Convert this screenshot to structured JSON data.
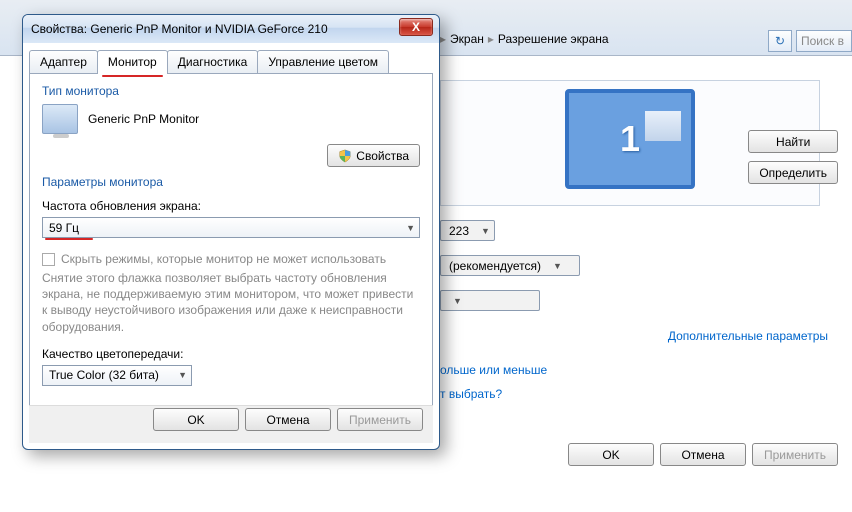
{
  "breadcrumb": {
    "item1": "Экран",
    "item2": "Разрешение экрана"
  },
  "search_placeholder": "Поиск в",
  "side": {
    "find": "Найти",
    "detect": "Определить"
  },
  "monitor_number": "1",
  "bg_rows": {
    "size": "223",
    "recommended": "(рекомендуется)"
  },
  "links": {
    "advanced": "Дополнительные параметры",
    "more_less": "ольше или меньше",
    "which": "т выбрать?"
  },
  "bottom": {
    "ok": "OK",
    "cancel": "Отмена",
    "apply": "Применить"
  },
  "dialog": {
    "title": "Свойства: Generic PnP Monitor и NVIDIA GeForce 210",
    "close": "X",
    "tabs": {
      "adapter": "Адаптер",
      "monitor": "Монитор",
      "diag": "Диагностика",
      "color": "Управление цветом"
    },
    "group_type": "Тип монитора",
    "monitor_name": "Generic PnP Monitor",
    "properties": "Свойства",
    "group_params": "Параметры монитора",
    "refresh_label": "Частота обновления экрана:",
    "refresh_value": "59 Гц",
    "hide_modes": "Скрыть режимы, которые монитор не может использовать",
    "hint": "Снятие этого флажка позволяет выбрать частоту обновления экрана, не поддерживаемую этим монитором, что может привести к выводу неустойчивого изображения или даже к неисправности оборудования.",
    "quality_label": "Качество цветопередачи:",
    "quality_value": "True Color (32 бита)",
    "ok": "OK",
    "cancel": "Отмена",
    "apply": "Применить"
  }
}
